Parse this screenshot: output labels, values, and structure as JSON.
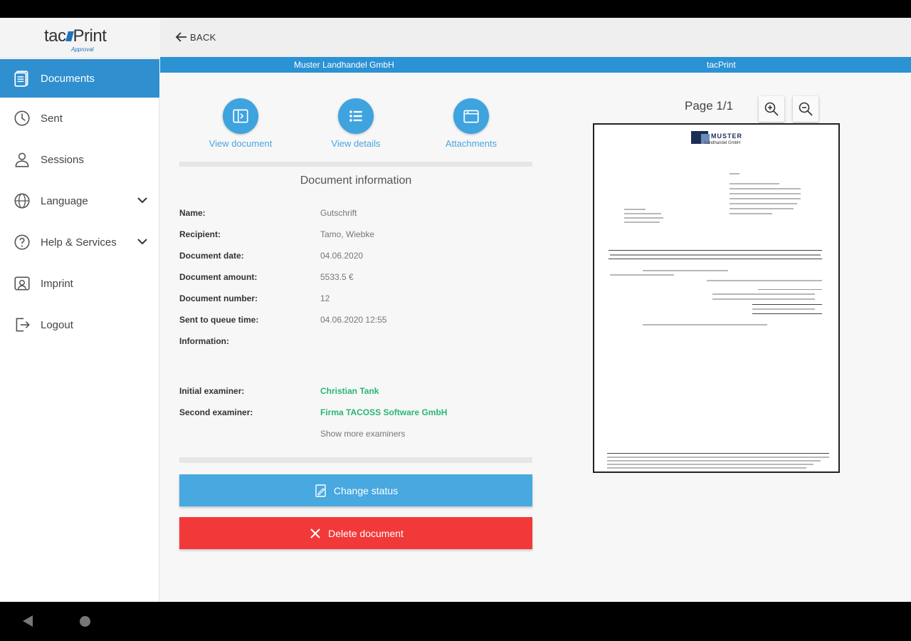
{
  "app": {
    "logo_text_left": "tac",
    "logo_text_right": "Print",
    "logo_sub": "Approval",
    "back_label": "BACK"
  },
  "sidebar": {
    "items": [
      {
        "label": "Documents",
        "icon": "document-icon"
      },
      {
        "label": "Sent",
        "icon": "clock-icon"
      },
      {
        "label": "Sessions",
        "icon": "user-icon"
      },
      {
        "label": "Language",
        "icon": "globe-icon"
      },
      {
        "label": "Help & Services",
        "icon": "help-icon"
      },
      {
        "label": "Imprint",
        "icon": "imprint-icon"
      },
      {
        "label": "Logout",
        "icon": "logout-icon"
      }
    ]
  },
  "header": {
    "company": "Muster Landhandel GmbH",
    "product": "tacPrint"
  },
  "actions": {
    "view_document": "View document",
    "view_details": "View details",
    "attachments": "Attachments"
  },
  "info": {
    "title": "Document information",
    "rows": [
      {
        "key": "Name:",
        "value": "Gutschrift"
      },
      {
        "key": "Recipient:",
        "value": "Tamo, Wiebke"
      },
      {
        "key": "Document date:",
        "value": "04.06.2020"
      },
      {
        "key": "Document amount:",
        "value": "5533.5 €"
      },
      {
        "key": "Document number:",
        "value": "12"
      },
      {
        "key": "Sent to queue time:",
        "value": "04.06.2020 12:55"
      },
      {
        "key": "Information:",
        "value": ""
      }
    ],
    "examiners": [
      {
        "key": "Initial examiner:",
        "value": "Christian Tank"
      },
      {
        "key": "Second examiner:",
        "value": "Firma TACOSS Software GmbH"
      }
    ],
    "show_more": "Show more examiners"
  },
  "buttons": {
    "change_status": "Change status",
    "delete_document": "Delete document"
  },
  "preview": {
    "page_label": "Page 1/1",
    "brand": "MUSTER",
    "brand_sub": "Landhandel GmbH"
  },
  "colors": {
    "accent": "#2f8fcf",
    "danger": "#f2393a",
    "examiner_green": "#2ab673"
  }
}
